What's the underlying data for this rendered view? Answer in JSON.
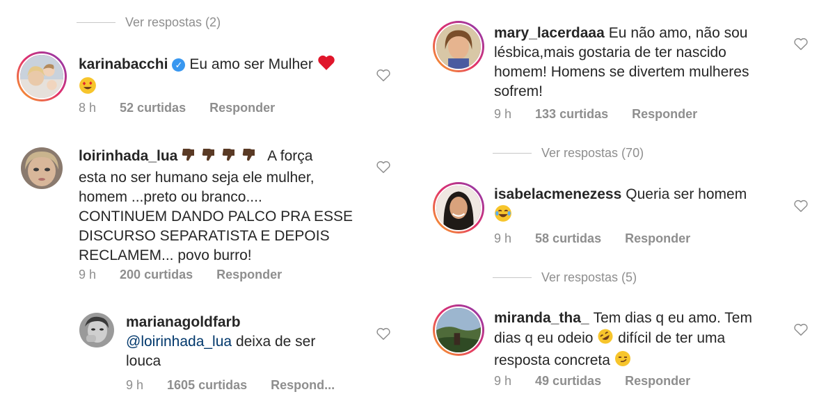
{
  "left": {
    "top_replies": "Ver respostas (2)",
    "c1": {
      "user": "karinabacchi",
      "text": "Eu amo ser Mulher",
      "time": "8 h",
      "likes": "52 curtidas",
      "reply": "Responder"
    },
    "c2": {
      "user": "loirinhada_lua",
      "line1": "A força",
      "line2": "esta no ser humano seja ele mulher,",
      "line3": "homem ...preto ou branco....",
      "line4": "CONTINUEM DANDO PALCO PRA ESSE",
      "line5": "DISCURSO SEPARATISTA E DEPOIS",
      "line6": "RECLAMEM... povo burro!",
      "time": "9 h",
      "likes": "200 curtidas",
      "reply": "Responder"
    },
    "c3": {
      "user": "marianagoldfarb",
      "mention": "@loirinhada_lua",
      "line1": "deixa de ser",
      "line2": "louca",
      "time": "9 h",
      "likes": "1605 curtidas",
      "reply": "Respond..."
    }
  },
  "right": {
    "c1": {
      "user": "mary_lacerdaaa",
      "line1": "Eu não amo, não sou",
      "line2": "lésbica,mais gostaria de ter nascido",
      "line3": "homem! Homens se divertem mulheres",
      "line4": "sofrem!",
      "time": "9 h",
      "likes": "133 curtidas",
      "reply": "Responder"
    },
    "replies1": "Ver respostas (70)",
    "c2": {
      "user": "isabelacmenezess",
      "text": "Queria ser homem",
      "time": "9 h",
      "likes": "58 curtidas",
      "reply": "Responder"
    },
    "replies2": "Ver respostas (5)",
    "c3": {
      "user": "miranda_tha_",
      "line1": "Tem dias q eu amo. Tem",
      "line2a": "dias q eu odeio",
      "line2b": "difícil de ter uma",
      "line3": "resposta concreta",
      "time": "9 h",
      "likes": "49 curtidas",
      "reply": "Responder"
    }
  },
  "icons": {
    "heart": "heart-outline-icon",
    "verified": "verified-badge-icon",
    "emojis": [
      "red-heart-emoji",
      "heart-eyes-emoji",
      "thumbs-down-emoji",
      "laughing-tears-emoji",
      "rofl-emoji",
      "smirk-emoji"
    ]
  }
}
